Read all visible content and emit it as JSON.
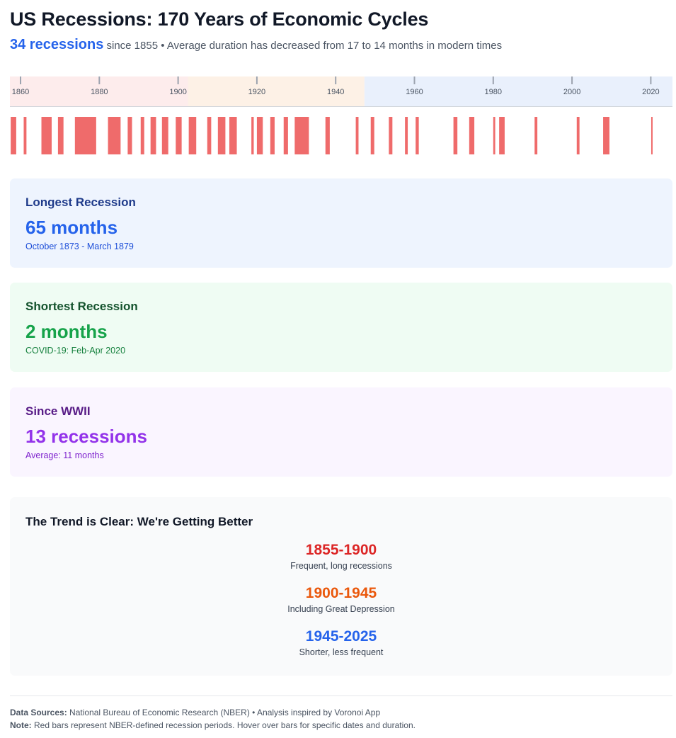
{
  "header": {
    "title": "US Recessions: 170 Years of Economic Cycles",
    "count": "34 recessions",
    "subtitle_rest": "since 1855 • Average duration has decreased from 17 to 14 months in modern times"
  },
  "chart_data": {
    "type": "timeline",
    "x_range": [
      1857.3,
      2025.5
    ],
    "tick_labels": [
      "1860",
      "1880",
      "1900",
      "1920",
      "1940",
      "1960",
      "1980",
      "2000",
      "2020"
    ],
    "ticks": [
      1860,
      1880,
      1900,
      1920,
      1940,
      1960,
      1980,
      2000,
      2020
    ],
    "eras": [
      {
        "start": 1857.3,
        "end": 1902.5,
        "color": "#fdecec"
      },
      {
        "start": 1902.5,
        "end": 1947.3,
        "color": "#fdf1e6"
      },
      {
        "start": 1947.3,
        "end": 2025.5,
        "color": "#e9f0fc"
      }
    ],
    "bar_color": "#ef6b6b",
    "recessions": [
      {
        "start": 1857.5,
        "end": 1858.9
      },
      {
        "start": 1860.8,
        "end": 1861.5
      },
      {
        "start": 1865.3,
        "end": 1867.9
      },
      {
        "start": 1869.5,
        "end": 1870.9
      },
      {
        "start": 1873.8,
        "end": 1879.2
      },
      {
        "start": 1882.2,
        "end": 1885.4
      },
      {
        "start": 1887.2,
        "end": 1888.3
      },
      {
        "start": 1890.5,
        "end": 1891.4
      },
      {
        "start": 1893.0,
        "end": 1894.4
      },
      {
        "start": 1895.9,
        "end": 1897.5
      },
      {
        "start": 1899.4,
        "end": 1900.9
      },
      {
        "start": 1902.7,
        "end": 1904.6
      },
      {
        "start": 1907.4,
        "end": 1908.4
      },
      {
        "start": 1910.1,
        "end": 1912.0
      },
      {
        "start": 1913.0,
        "end": 1914.9
      },
      {
        "start": 1918.6,
        "end": 1919.2
      },
      {
        "start": 1920.0,
        "end": 1921.5
      },
      {
        "start": 1923.4,
        "end": 1924.5
      },
      {
        "start": 1926.8,
        "end": 1927.9
      },
      {
        "start": 1929.6,
        "end": 1933.2
      },
      {
        "start": 1937.4,
        "end": 1938.5
      },
      {
        "start": 1945.1,
        "end": 1945.8
      },
      {
        "start": 1948.9,
        "end": 1949.8
      },
      {
        "start": 1953.5,
        "end": 1954.4
      },
      {
        "start": 1957.6,
        "end": 1958.3
      },
      {
        "start": 1960.3,
        "end": 1961.1
      },
      {
        "start": 1969.9,
        "end": 1970.9
      },
      {
        "start": 1973.9,
        "end": 1975.2
      },
      {
        "start": 1980.0,
        "end": 1980.5
      },
      {
        "start": 1981.5,
        "end": 1982.9
      },
      {
        "start": 1990.5,
        "end": 1991.2
      },
      {
        "start": 2001.2,
        "end": 2001.9
      },
      {
        "start": 2007.9,
        "end": 2009.5
      },
      {
        "start": 2020.1,
        "end": 2020.3
      }
    ]
  },
  "cards": [
    {
      "title": "Longest Recession",
      "value": "65 months",
      "sub": "October 1873 - March 1879"
    },
    {
      "title": "Shortest Recession",
      "value": "2 months",
      "sub": "COVID-19: Feb-Apr 2020"
    },
    {
      "title": "Since WWII",
      "value": "13 recessions",
      "sub": "Average: 11 months"
    }
  ],
  "trend": {
    "title": "The Trend is Clear: We're Getting Better",
    "eras": [
      {
        "period": "1855-1900",
        "desc": "Frequent, long recessions"
      },
      {
        "period": "1900-1945",
        "desc": "Including Great Depression"
      },
      {
        "period": "1945-2025",
        "desc": "Shorter, less frequent"
      }
    ]
  },
  "footer": {
    "sources_label": "Data Sources:",
    "sources_text": "National Bureau of Economic Research (NBER) • Analysis inspired by Voronoi App",
    "note_label": "Note:",
    "note_text": "Red bars represent NBER-defined recession periods. Hover over bars for specific dates and duration."
  }
}
